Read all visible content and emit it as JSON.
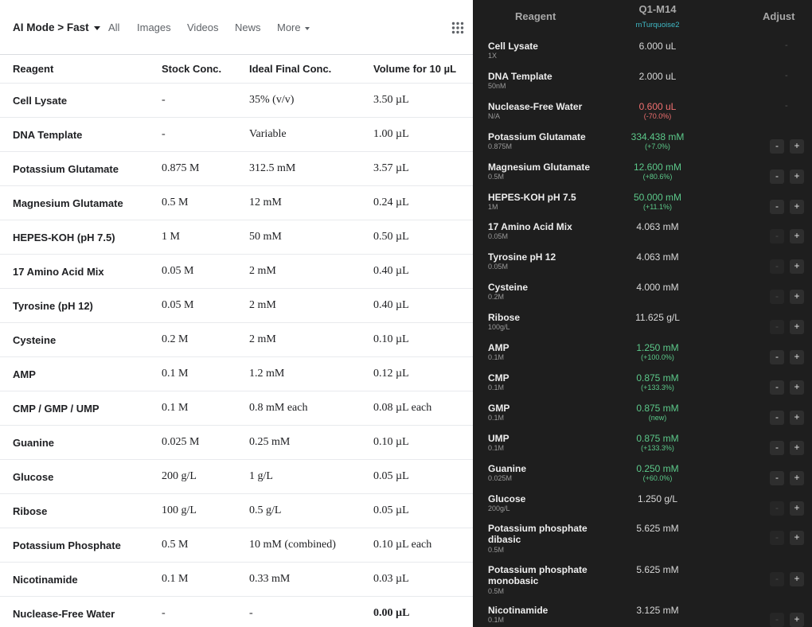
{
  "nav": {
    "mode_label": "AI Mode > Fast",
    "all": "All",
    "images": "Images",
    "videos": "Videos",
    "news": "News",
    "more": "More"
  },
  "left_table": {
    "headers": [
      "Reagent",
      "Stock Conc.",
      "Ideal Final Conc.",
      "Volume for 10 µL"
    ],
    "rows": [
      [
        "Cell Lysate",
        "-",
        "35% (v/v)",
        "3.50 µL"
      ],
      [
        "DNA Template",
        "-",
        "Variable",
        "1.00 µL"
      ],
      [
        "Potassium Glutamate",
        "0.875 M",
        "312.5 mM",
        "3.57 µL"
      ],
      [
        "Magnesium Glutamate",
        "0.5 M",
        "12 mM",
        "0.24 µL"
      ],
      [
        "HEPES-KOH (pH 7.5)",
        "1 M",
        "50 mM",
        "0.50 µL"
      ],
      [
        "17 Amino Acid Mix",
        "0.05 M",
        "2 mM",
        "0.40 µL"
      ],
      [
        "Tyrosine (pH 12)",
        "0.05 M",
        "2 mM",
        "0.40 µL"
      ],
      [
        "Cysteine",
        "0.2 M",
        "2 mM",
        "0.10 µL"
      ],
      [
        "AMP",
        "0.1 M",
        "1.2 mM",
        "0.12 µL"
      ],
      [
        "CMP / GMP / UMP",
        "0.1 M",
        "0.8 mM each",
        "0.08 µL each"
      ],
      [
        "Guanine",
        "0.025 M",
        "0.25 mM",
        "0.10 µL"
      ],
      [
        "Glucose",
        "200 g/L",
        "1 g/L",
        "0.05 µL"
      ],
      [
        "Ribose",
        "100 g/L",
        "0.5 g/L",
        "0.05 µL"
      ],
      [
        "Potassium Phosphate",
        "0.5 M",
        "10 mM (combined)",
        "0.10 µL each"
      ],
      [
        "Nicotinamide",
        "0.1 M",
        "0.33 mM",
        "0.03 µL"
      ],
      [
        "Nuclease-Free Water",
        "-",
        "-",
        "0.00 µL"
      ]
    ]
  },
  "right_panel": {
    "header_reagent": "Reagent",
    "header_sample": "Q1-M14",
    "header_sample_sub": "mTurquoise2",
    "header_adjust": "Adjust",
    "rows": [
      {
        "name": "Cell Lysate",
        "stock": "1X",
        "value": "6.000 uL",
        "delta": "",
        "tone": "normal",
        "adjust": "dash"
      },
      {
        "name": "DNA Template",
        "stock": "50nM",
        "value": "2.000 uL",
        "delta": "",
        "tone": "normal",
        "adjust": "dash"
      },
      {
        "name": "Nuclease-Free Water",
        "stock": "N/A",
        "value": "0.600 uL",
        "delta": "(-70.0%)",
        "tone": "red",
        "adjust": "dash"
      },
      {
        "name": "Potassium Glutamate",
        "stock": "0.875M",
        "value": "334.438 mM",
        "delta": "(+7.0%)",
        "tone": "green",
        "adjust": "both"
      },
      {
        "name": "Magnesium Glutamate",
        "stock": "0.5M",
        "value": "12.600 mM",
        "delta": "(+80.6%)",
        "tone": "green",
        "adjust": "both"
      },
      {
        "name": "HEPES-KOH pH 7.5",
        "stock": "1M",
        "value": "50.000 mM",
        "delta": "(+11.1%)",
        "tone": "green",
        "adjust": "both"
      },
      {
        "name": "17 Amino Acid Mix",
        "stock": "0.05M",
        "value": "4.063 mM",
        "delta": "",
        "tone": "normal",
        "adjust": "plus"
      },
      {
        "name": "Tyrosine pH 12",
        "stock": "0.05M",
        "value": "4.063 mM",
        "delta": "",
        "tone": "normal",
        "adjust": "plus"
      },
      {
        "name": "Cysteine",
        "stock": "0.2M",
        "value": "4.000 mM",
        "delta": "",
        "tone": "normal",
        "adjust": "plus"
      },
      {
        "name": "Ribose",
        "stock": "100g/L",
        "value": "11.625 g/L",
        "delta": "",
        "tone": "normal",
        "adjust": "plus"
      },
      {
        "name": "AMP",
        "stock": "0.1M",
        "value": "1.250 mM",
        "delta": "(+100.0%)",
        "tone": "green",
        "adjust": "both"
      },
      {
        "name": "CMP",
        "stock": "0.1M",
        "value": "0.875 mM",
        "delta": "(+133.3%)",
        "tone": "green",
        "adjust": "both"
      },
      {
        "name": "GMP",
        "stock": "0.1M",
        "value": "0.875 mM",
        "delta": "(new)",
        "tone": "green",
        "adjust": "both"
      },
      {
        "name": "UMP",
        "stock": "0.1M",
        "value": "0.875 mM",
        "delta": "(+133.3%)",
        "tone": "green",
        "adjust": "both"
      },
      {
        "name": "Guanine",
        "stock": "0.025M",
        "value": "0.250 mM",
        "delta": "(+60.0%)",
        "tone": "green",
        "adjust": "both"
      },
      {
        "name": "Glucose",
        "stock": "200g/L",
        "value": "1.250 g/L",
        "delta": "",
        "tone": "normal",
        "adjust": "plus"
      },
      {
        "name": "Potassium phosphate dibasic",
        "stock": "0.5M",
        "value": "5.625 mM",
        "delta": "",
        "tone": "normal",
        "adjust": "plus"
      },
      {
        "name": "Potassium phosphate monobasic",
        "stock": "0.5M",
        "value": "5.625 mM",
        "delta": "",
        "tone": "normal",
        "adjust": "plus"
      },
      {
        "name": "Nicotinamide",
        "stock": "0.1M",
        "value": "3.125 mM",
        "delta": "",
        "tone": "normal",
        "adjust": "plus"
      }
    ],
    "minus_label": "-",
    "plus_label": "+",
    "dash_label": "-"
  },
  "colors": {
    "green": "#5cc98a",
    "red": "#f07070",
    "accent_cyan": "#3fb8c4",
    "dark_bg": "#1e1e1e"
  }
}
